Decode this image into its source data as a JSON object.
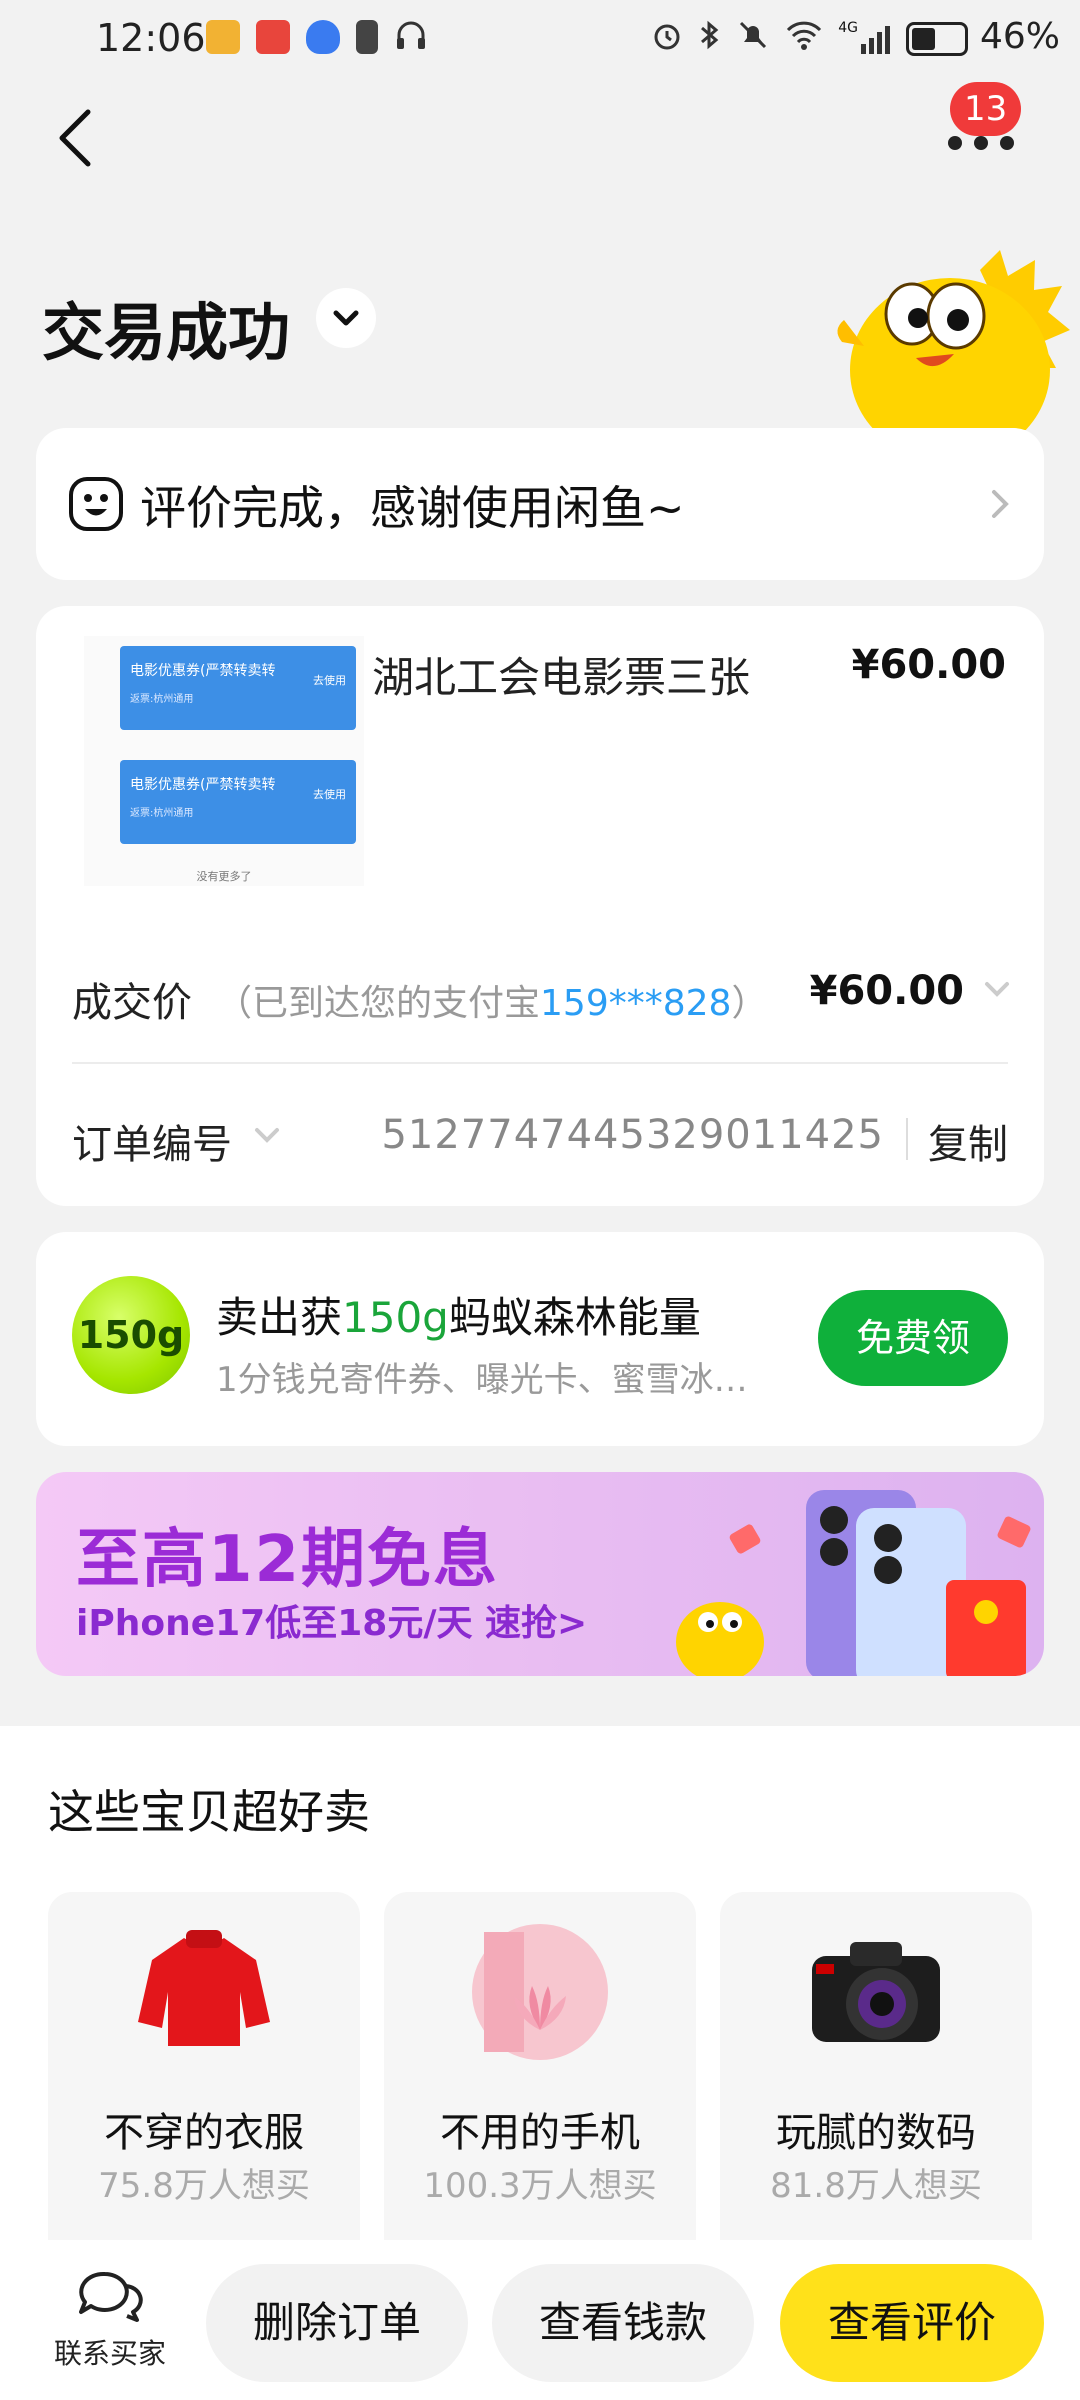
{
  "status_bar": {
    "time": "12:06",
    "network": "4G",
    "battery_percent": "46%",
    "battery_level": 0.46
  },
  "header": {
    "notification_count": "13",
    "title": "交易成功"
  },
  "review_banner": {
    "text": "评价完成，感谢使用闲鱼~"
  },
  "order": {
    "item_title": "湖北工会电影票三张",
    "item_price": "¥60.00",
    "thumbnail": {
      "ticket_title": "电影优惠券(严禁转卖转",
      "ticket_detail": "返票:杭州通用",
      "ticket_status": "去使用",
      "note": "没有更多了"
    },
    "deal_label": "成交价",
    "deal_note_prefix": "（已到达您的支付宝",
    "deal_note_phone": "159***828",
    "deal_note_suffix": "）",
    "deal_price": "¥60.00",
    "order_no_label": "订单编号",
    "order_no": "5127747445329011425",
    "copy_label": "复制"
  },
  "energy": {
    "badge": "150g",
    "title_prefix": "卖出获",
    "title_highlight": "150g",
    "title_suffix": "蚂蚁森林能量",
    "subtitle": "1分钱兑寄件券、曝光卡、蜜雪冰…",
    "button": "免费领"
  },
  "promo": {
    "title": "至高12期免息",
    "subtitle": "iPhone17低至18元/天  速抢>"
  },
  "recommend": {
    "title": "这些宝贝超好卖",
    "items": [
      {
        "name": "不穿的衣服",
        "count": "75.8万人想买"
      },
      {
        "name": "不用的手机",
        "count": "100.3万人想买"
      },
      {
        "name": "玩腻的数码",
        "count": "81.8万人想买"
      }
    ]
  },
  "bottom_bar": {
    "contact": "联系买家",
    "delete": "删除订单",
    "view_payment": "查看钱款",
    "view_review": "查看评价"
  },
  "colors": {
    "accent_yellow": "#ffe11a",
    "green": "#0fb03b",
    "badge_red": "#f03a3a",
    "link_blue": "#2a9df4",
    "promo_purple": "#9b2bd6"
  }
}
